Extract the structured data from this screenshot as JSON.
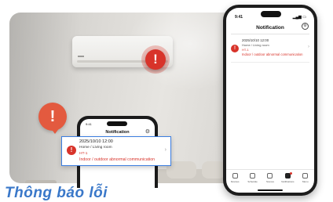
{
  "caption": "Thông báo lỗi",
  "room": {
    "ac_alert_symbol": "!",
    "bubble_symbol": "!"
  },
  "small_phone": {
    "time": "9:41",
    "title": "Notification",
    "gear_icon": "gear-icon"
  },
  "popup": {
    "symbol": "!",
    "date": "2025/10/10 12:00",
    "location": "Home / Living room",
    "code": "HT-1",
    "message": "Indoor / outdoor abnormal communication",
    "chevron": "›"
  },
  "big_phone": {
    "time": "9:41",
    "signal": "▂▄▆ ▭",
    "title": "Notification",
    "gear": "⚙",
    "notification": {
      "symbol": "!",
      "date": "2025/10/10 12:00",
      "location": "Home / Living room",
      "code": "HT-1",
      "message": "Indoor / outdoor abnormal communication",
      "chevron": "›"
    },
    "nav": [
      {
        "label": "Devices"
      },
      {
        "label": "Schedule"
      },
      {
        "label": "Scenes"
      },
      {
        "label": "Notifications"
      },
      {
        "label": "Menu"
      }
    ]
  },
  "colors": {
    "alert_red": "#d8332a",
    "caption_blue": "#3a78c9",
    "popup_border": "#3b7de0"
  }
}
